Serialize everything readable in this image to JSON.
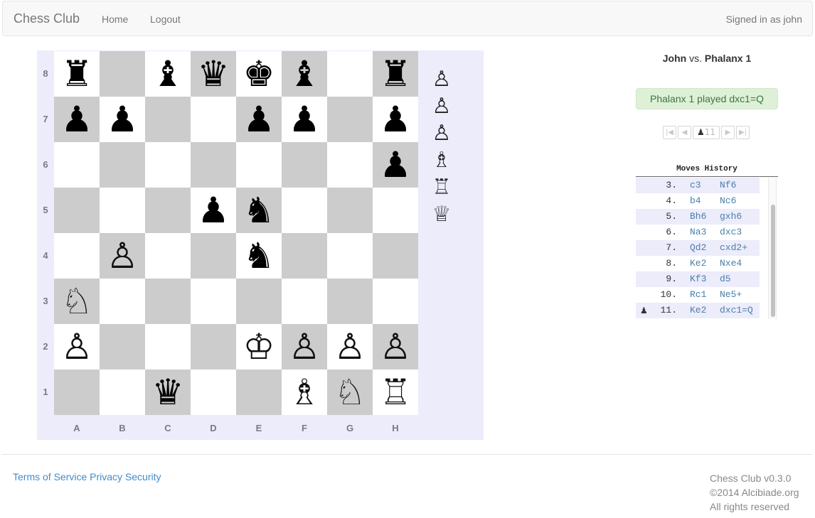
{
  "navbar": {
    "brand": "Chess Club",
    "links": [
      {
        "label": "Home"
      },
      {
        "label": "Logout"
      }
    ],
    "signed_in": "Signed in as john"
  },
  "board": {
    "ranks": [
      "8",
      "7",
      "6",
      "5",
      "4",
      "3",
      "2",
      "1"
    ],
    "files": [
      "A",
      "B",
      "C",
      "D",
      "E",
      "F",
      "G",
      "H"
    ],
    "pieces": [
      {
        "square": "a8",
        "color": "black",
        "type": "rook",
        "glyph": "♜"
      },
      {
        "square": "c8",
        "color": "black",
        "type": "bishop",
        "glyph": "♝"
      },
      {
        "square": "d8",
        "color": "black",
        "type": "queen",
        "glyph": "♛"
      },
      {
        "square": "e8",
        "color": "black",
        "type": "king",
        "glyph": "♚"
      },
      {
        "square": "f8",
        "color": "black",
        "type": "bishop",
        "glyph": "♝"
      },
      {
        "square": "h8",
        "color": "black",
        "type": "rook",
        "glyph": "♜"
      },
      {
        "square": "a7",
        "color": "black",
        "type": "pawn",
        "glyph": "♟"
      },
      {
        "square": "b7",
        "color": "black",
        "type": "pawn",
        "glyph": "♟"
      },
      {
        "square": "e7",
        "color": "black",
        "type": "pawn",
        "glyph": "♟"
      },
      {
        "square": "f7",
        "color": "black",
        "type": "pawn",
        "glyph": "♟"
      },
      {
        "square": "h7",
        "color": "black",
        "type": "pawn",
        "glyph": "♟"
      },
      {
        "square": "h6",
        "color": "black",
        "type": "pawn",
        "glyph": "♟"
      },
      {
        "square": "d5",
        "color": "black",
        "type": "pawn",
        "glyph": "♟"
      },
      {
        "square": "e5",
        "color": "black",
        "type": "knight",
        "glyph": "♞"
      },
      {
        "square": "e4",
        "color": "black",
        "type": "knight",
        "glyph": "♞"
      },
      {
        "square": "b4",
        "color": "white",
        "type": "pawn",
        "glyph": "♙"
      },
      {
        "square": "a3",
        "color": "white",
        "type": "knight",
        "glyph": "♘"
      },
      {
        "square": "a2",
        "color": "white",
        "type": "pawn",
        "glyph": "♙"
      },
      {
        "square": "e2",
        "color": "white",
        "type": "king",
        "glyph": "♔"
      },
      {
        "square": "f2",
        "color": "white",
        "type": "pawn",
        "glyph": "♙"
      },
      {
        "square": "g2",
        "color": "white",
        "type": "pawn",
        "glyph": "♙"
      },
      {
        "square": "h2",
        "color": "white",
        "type": "pawn",
        "glyph": "♙"
      },
      {
        "square": "c1",
        "color": "black",
        "type": "queen",
        "glyph": "♛"
      },
      {
        "square": "f1",
        "color": "white",
        "type": "bishop",
        "glyph": "♗"
      },
      {
        "square": "g1",
        "color": "white",
        "type": "knight",
        "glyph": "♘"
      },
      {
        "square": "h1",
        "color": "white",
        "type": "rook",
        "glyph": "♖"
      }
    ],
    "captured_white": [
      {
        "type": "pawn",
        "glyph": "♙"
      },
      {
        "type": "pawn",
        "glyph": "♙"
      },
      {
        "type": "pawn",
        "glyph": "♙"
      },
      {
        "type": "bishop",
        "glyph": "♗"
      },
      {
        "type": "rook",
        "glyph": "♖"
      },
      {
        "type": "queen",
        "glyph": "♕"
      }
    ],
    "colors": {
      "light": "#ffffff",
      "dark": "#cccccc",
      "frame": "#ececfb"
    }
  },
  "game": {
    "white_player": "John",
    "vs": "vs.",
    "black_player": "Phalanx 1",
    "status": "Phalanx 1 played dxc1=Q",
    "pager": {
      "first_icon": "skip-first-icon",
      "prev_icon": "step-back-icon",
      "turn_glyph": "♟",
      "move_number": "11",
      "next_icon": "step-forward-icon",
      "last_icon": "skip-last-icon"
    }
  },
  "moves_history": {
    "title": "Moves History",
    "current_marker": "♟",
    "rows": [
      {
        "num": "3.",
        "white": "c3",
        "black": "Nf6"
      },
      {
        "num": "4.",
        "white": "b4",
        "black": "Nc6"
      },
      {
        "num": "5.",
        "white": "Bh6",
        "black": "gxh6"
      },
      {
        "num": "6.",
        "white": "Na3",
        "black": "dxc3"
      },
      {
        "num": "7.",
        "white": "Qd2",
        "black": "cxd2+"
      },
      {
        "num": "8.",
        "white": "Ke2",
        "black": "Nxe4"
      },
      {
        "num": "9.",
        "white": "Kf3",
        "black": "d5"
      },
      {
        "num": "10.",
        "white": "Rc1",
        "black": "Ne5+"
      },
      {
        "num": "11.",
        "white": "Ke2",
        "black": "dxc1=Q",
        "current": true
      }
    ]
  },
  "footer": {
    "links": [
      {
        "label": "Terms of Service"
      },
      {
        "label": "Privacy"
      },
      {
        "label": "Security"
      }
    ],
    "version": "Chess Club v0.3.0",
    "copyright": "©2014 Alcibiade.org",
    "rights": "All rights reserved"
  }
}
